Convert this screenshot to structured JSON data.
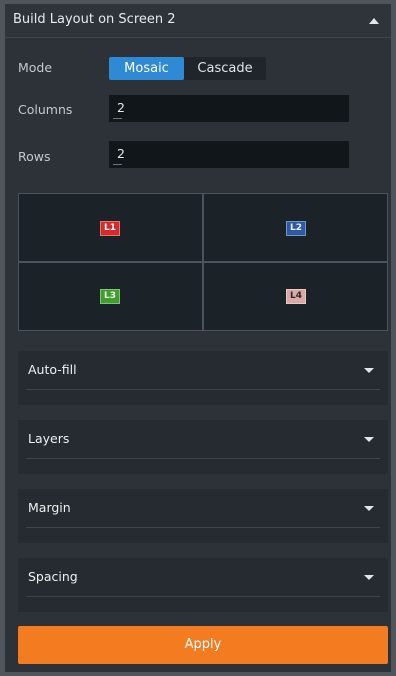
{
  "header": {
    "title": "Build Layout on Screen 2"
  },
  "mode": {
    "label": "Mode",
    "options": [
      "Mosaic",
      "Cascade"
    ],
    "selected": "Mosaic"
  },
  "columns": {
    "label": "Columns",
    "value": "2"
  },
  "rows": {
    "label": "Rows",
    "value": "2"
  },
  "layers": [
    {
      "label": "L1",
      "color": "#d62b2b"
    },
    {
      "label": "L2",
      "color": "#2c5aa5"
    },
    {
      "label": "L3",
      "color": "#3f9e2e"
    },
    {
      "label": "L4",
      "color": "#d8a9a7"
    }
  ],
  "sections": [
    {
      "title": "Auto-fill"
    },
    {
      "title": "Layers"
    },
    {
      "title": "Margin"
    },
    {
      "title": "Spacing"
    }
  ],
  "apply_label": "Apply"
}
